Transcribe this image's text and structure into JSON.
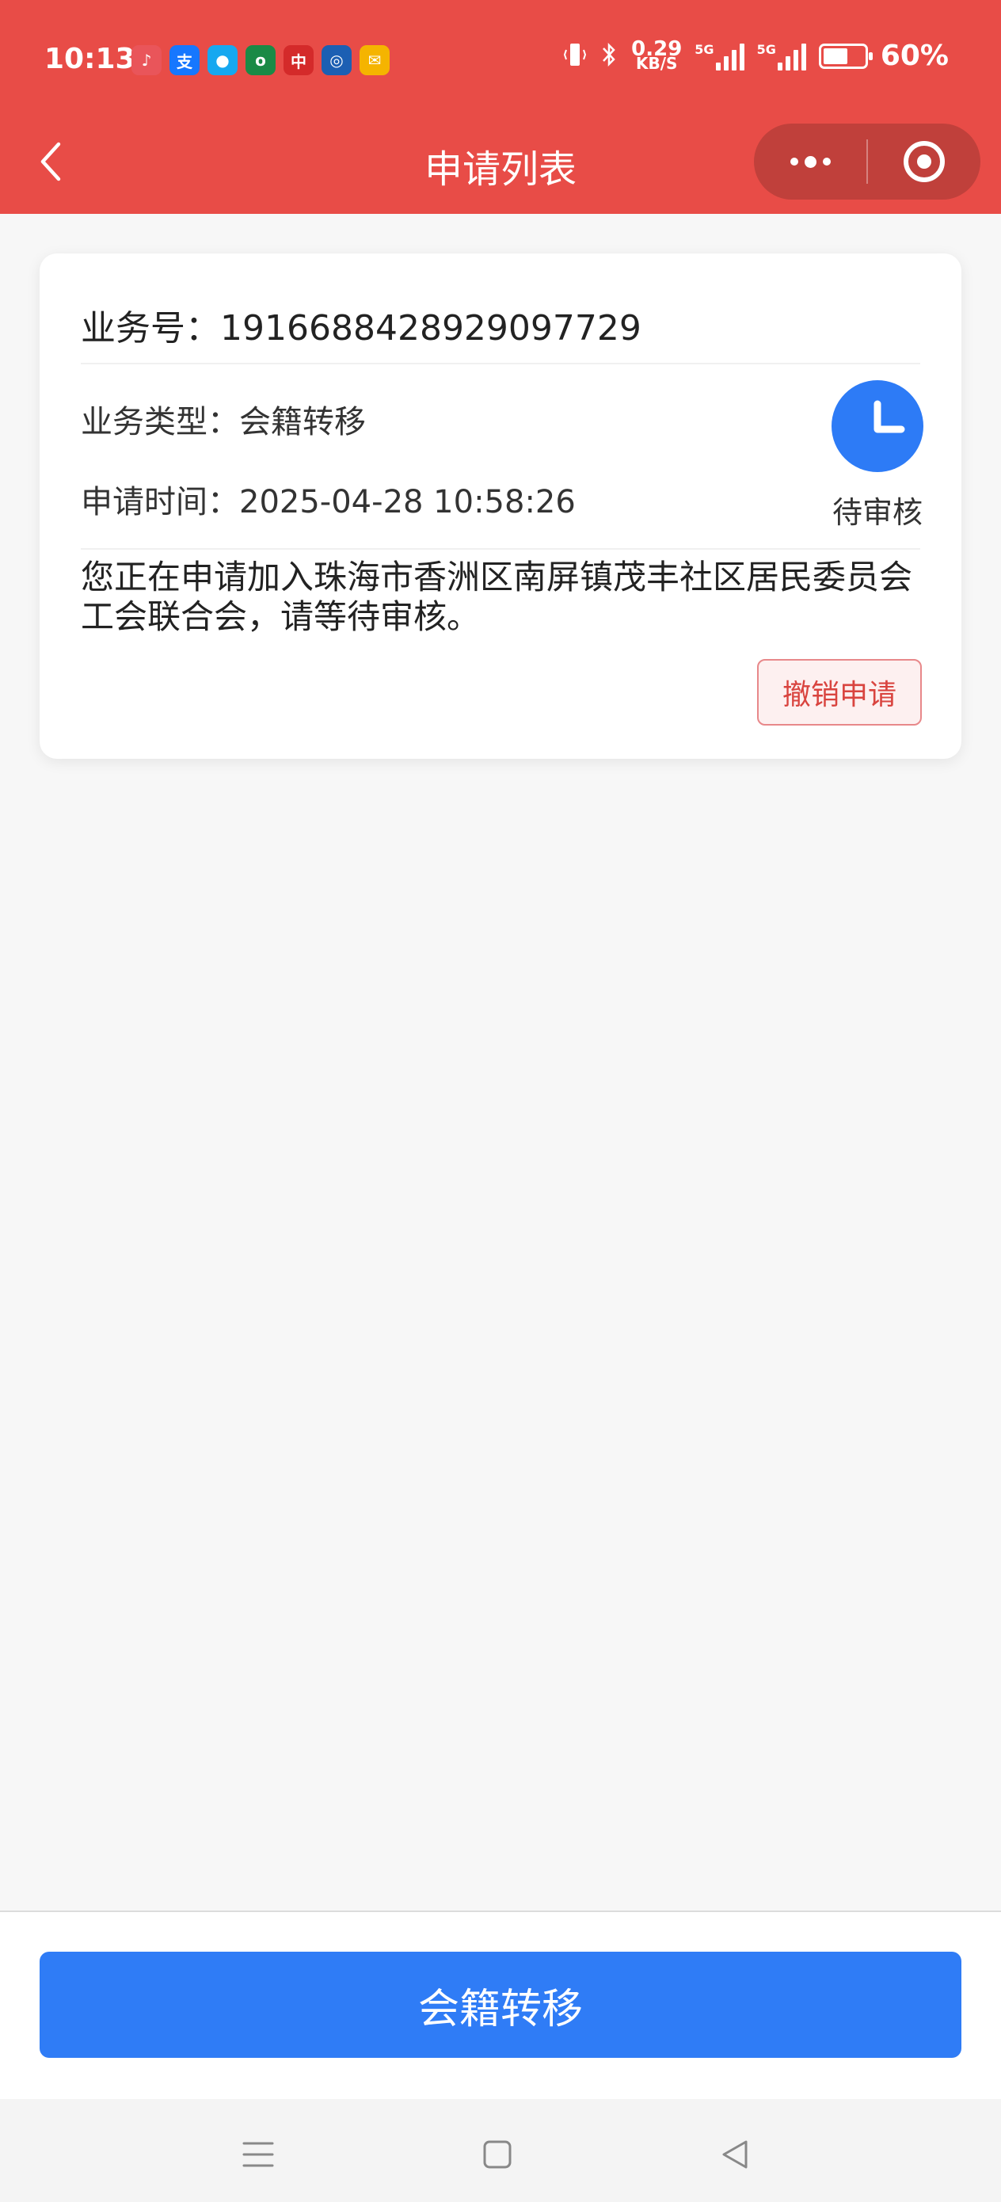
{
  "status_bar": {
    "time": "10:13",
    "net_speed_value": "0.29",
    "net_speed_unit": "KB/S",
    "sim1_label": "5G",
    "sim2_label": "5G",
    "battery_percent": "60%",
    "battery_level": 0.6,
    "app_icons": [
      {
        "name": "app1-icon",
        "color": "#e9555a",
        "glyph": "♪"
      },
      {
        "name": "alipay-icon",
        "color": "#1677ff",
        "glyph": "支"
      },
      {
        "name": "qq-icon",
        "color": "#16a8f0",
        "glyph": "●"
      },
      {
        "name": "oppo-icon",
        "color": "#1a8a46",
        "glyph": "o"
      },
      {
        "name": "app5-icon",
        "color": "#d42a2a",
        "glyph": "中"
      },
      {
        "name": "app6-icon",
        "color": "#1c5fb3",
        "glyph": "◎"
      },
      {
        "name": "mail-icon",
        "color": "#f5b400",
        "glyph": "✉"
      }
    ]
  },
  "nav": {
    "title": "申请列表"
  },
  "card": {
    "business_no_label": "业务号：",
    "business_no": "1916688428929097729",
    "type_label": "业务类型：",
    "type_value": "会籍转移",
    "time_label": "申请时间：",
    "time_value": "2025-04-28 10:58:26",
    "status": "待审核",
    "message": "您正在申请加入珠海市香洲区南屏镇茂丰社区居民委员会工会联合会，请等待审核。",
    "cancel_label": "撤销申请"
  },
  "bottom": {
    "primary_label": "会籍转移"
  },
  "colors": {
    "header_red": "#e84c47",
    "primary_blue": "#2f7cf6",
    "status_blue": "#2d7bf6",
    "cancel_red": "#d9443f"
  }
}
